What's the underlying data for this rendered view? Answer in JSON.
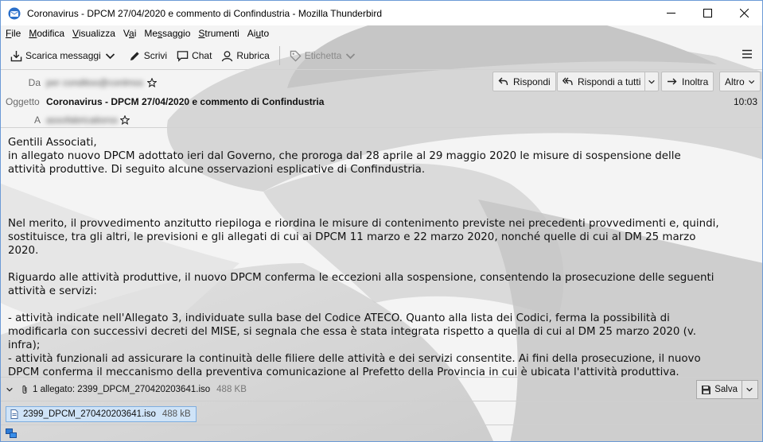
{
  "window": {
    "title": "Coronavirus - DPCM 27/04/2020 e commento di Confindustria - Mozilla Thunderbird"
  },
  "menu": {
    "items": [
      {
        "label_pre": "",
        "accel": "F",
        "label_post": "ile"
      },
      {
        "label_pre": "",
        "accel": "M",
        "label_post": "odifica"
      },
      {
        "label_pre": "",
        "accel": "V",
        "label_post": "isualizza"
      },
      {
        "label_pre": "V",
        "accel": "a",
        "label_post": "i"
      },
      {
        "label_pre": "Me",
        "accel": "s",
        "label_post": "saggio"
      },
      {
        "label_pre": "",
        "accel": "S",
        "label_post": "trumenti"
      },
      {
        "label_pre": "Ai",
        "accel": "u",
        "label_post": "to"
      }
    ]
  },
  "toolbar": {
    "get_messages": "Scarica messaggi",
    "write": "Scrivi",
    "chat": "Chat",
    "address_book": "Rubrica",
    "tag": "Etichetta"
  },
  "header": {
    "from_label": "Da",
    "from_value": "per conditoo@conlmss",
    "subject_label": "Oggetto",
    "subject_value": "Coronavirus - DPCM 27/04/2020 e commento di Confindustria",
    "to_label": "A",
    "to_value": "assofabricatiorss",
    "time": "10:03",
    "reply": "Rispondi",
    "reply_all": "Rispondi a tutti",
    "forward": "Inoltra",
    "other": "Altro"
  },
  "body": {
    "p1_l1": "Gentili Associati,",
    "p1_l2": "in allegato  nuovo DPCM adottato ieri dal Governo, che proroga dal 28 aprile al 29 maggio 2020 le misure di sospensione delle",
    "p1_l3": "attività produttive. Di seguito alcune osservazioni esplicative di Confindustria.",
    "p2_l1": "Nel merito, il provvedimento anzitutto riepiloga e riordina le misure di contenimento previste nei precedenti provvedimenti e, quindi,",
    "p2_l2": "sostituisce, tra gli altri, le previsioni e gli allegati di cui ai DPCM 11 marzo e 22 marzo 2020, nonché quelle di cui al DM 25 marzo",
    "p2_l3": "2020.",
    "p3_l1": "Riguardo alle attività produttive, il nuovo DPCM conferma le eccezioni alla sospensione, consentendo la prosecuzione delle seguenti",
    "p3_l2": "attività e servizi:",
    "p4_l1": "- attività indicate nell'Allegato 3, individuate sulla base del Codice ATECO. Quanto alla lista dei Codici, ferma la possibilità di",
    "p4_l2": "modificarla con successivi decreti del MISE, si segnala che essa è stata integrata rispetto a quella di cui al DM 25 marzo 2020 (v.",
    "p4_l3": "infra);",
    "p5_l1": "- attività funzionali ad assicurare la continuità delle filiere delle attività e dei servizi consentite. Ai fini della prosecuzione, il nuovo",
    "p5_l2": "DPCM conferma il meccanismo della preventiva comunicazione al Prefetto della Provincia in cui è ubicata l'attività produttiva."
  },
  "attachments": {
    "summary": "1 allegato: 2399_DPCM_270420203641.iso",
    "summary_size": "488 KB",
    "save": "Salva",
    "file_name": "2399_DPCM_270420203641.iso",
    "file_size": "488 kB"
  }
}
